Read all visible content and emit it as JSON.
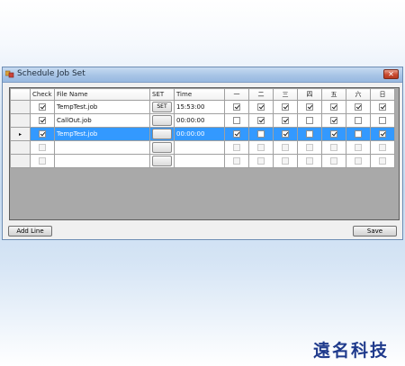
{
  "window": {
    "title": "Schedule Job Set",
    "close_label": "✕"
  },
  "grid": {
    "columns": [
      "",
      "Check",
      "File Name",
      "SET",
      "Time",
      "一",
      "二",
      "三",
      "四",
      "五",
      "六",
      "日"
    ],
    "rows": [
      {
        "marker": "",
        "check": true,
        "file": "TempTest.job",
        "set": "SET",
        "time": "15:53:00",
        "days": [
          true,
          true,
          true,
          true,
          true,
          true,
          true
        ],
        "selected": false,
        "enabled": true
      },
      {
        "marker": "",
        "check": true,
        "file": "CallOut.job",
        "set": "",
        "time": "00:00:00",
        "days": [
          false,
          true,
          true,
          false,
          true,
          false,
          false
        ],
        "selected": false,
        "enabled": true
      },
      {
        "marker": "▸",
        "check": true,
        "file": "TempTest.job",
        "set": "",
        "time": "00:00:00",
        "days": [
          true,
          false,
          true,
          false,
          true,
          false,
          true
        ],
        "selected": true,
        "enabled": true
      },
      {
        "marker": "",
        "check": false,
        "file": "",
        "set": "",
        "time": "",
        "days": [
          false,
          false,
          false,
          false,
          false,
          false,
          false
        ],
        "selected": false,
        "enabled": false
      },
      {
        "marker": "",
        "check": false,
        "file": "",
        "set": "",
        "time": "",
        "days": [
          false,
          false,
          false,
          false,
          false,
          false,
          false
        ],
        "selected": false,
        "enabled": false
      }
    ]
  },
  "buttons": {
    "add_line": "Add Line",
    "save": "Save"
  },
  "watermark": "遠名科技"
}
